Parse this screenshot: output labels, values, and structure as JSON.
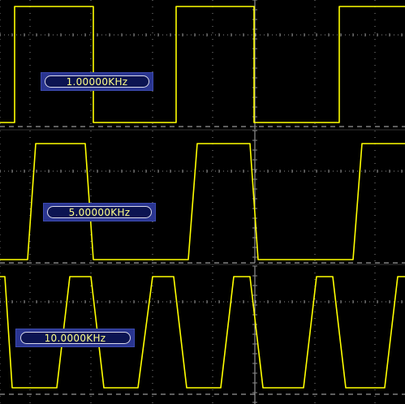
{
  "colors": {
    "background": "#000000",
    "trace": "#ffff00",
    "graticule": "#8a8a8a",
    "label_box": "#2a3590",
    "label_text": "#ffff88"
  },
  "panels": [
    {
      "frequency_label": "1.00000KHz"
    },
    {
      "frequency_label": "5.00000KHz"
    },
    {
      "frequency_label": "10.0000KHz"
    }
  ]
}
